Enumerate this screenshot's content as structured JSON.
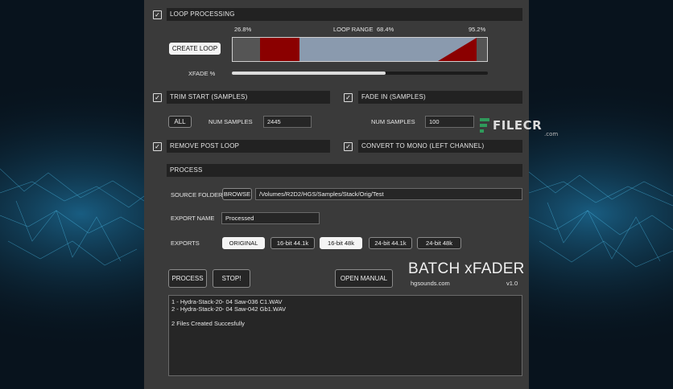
{
  "loop": {
    "checkbox": "✓",
    "title": "LOOP PROCESSING",
    "start_pct": "26.8%",
    "range_label": "LOOP RANGE",
    "range_pct": "68.4%",
    "end_pct": "95.2%",
    "create_button": "CREATE LOOP",
    "xfade_label": "XFADE %",
    "xfade_fraction": 0.6
  },
  "trim": {
    "checkbox": "✓",
    "title": "TRIM START (SAMPLES)",
    "all_button": "ALL",
    "num_label": "NUM SAMPLES",
    "num_value": "2445"
  },
  "fade": {
    "checkbox": "✓",
    "title": "FADE IN (SAMPLES)",
    "num_label": "NUM SAMPLES",
    "num_value": "100"
  },
  "remove_post": {
    "checkbox": "✓",
    "title": "REMOVE POST LOOP"
  },
  "mono": {
    "checkbox": "✓",
    "title": "CONVERT TO MONO (LEFT CHANNEL)"
  },
  "process_section": {
    "title": "PROCESS",
    "source_label": "SOURCE FOLDER",
    "browse_button": "BROWSE",
    "source_path": "/Volumes/R2D2/HGS/Samples/Stack/Orig/Test",
    "export_name_label": "EXPORT NAME",
    "export_name_value": "Processed",
    "exports_label": "EXPORTS",
    "export_options": [
      "ORIGINAL",
      "16-bit 44.1k",
      "16-bit 48k",
      "24-bit 44.1k",
      "24-bit 48k"
    ],
    "export_selected": [
      true,
      false,
      true,
      false,
      false
    ]
  },
  "actions": {
    "process_button": "PROCESS",
    "stop_button": "STOP!",
    "manual_button": "OPEN MANUAL"
  },
  "brand": {
    "title": "BATCH xFADER",
    "site": "hgsounds.com",
    "version": "v1.0"
  },
  "log": [
    "1 - Hydra-Stack-20- 04 Saw-036 C1.WAV",
    "2 - Hydra-Stack-20- 04 Saw-042 Gb1.WAV",
    "",
    "2 Files Created Succesfully"
  ],
  "watermark": {
    "brand": "FILECR",
    "suffix": ".com"
  },
  "colors": {
    "panel": "#3a3a3a",
    "bar": "#222222",
    "loop_red": "#8b0000",
    "loop_range": "#8a9aae"
  }
}
